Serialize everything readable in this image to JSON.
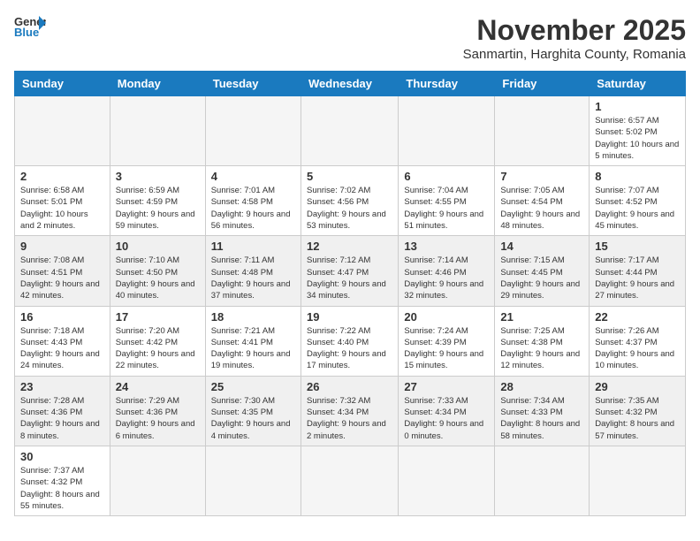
{
  "logo": {
    "text_general": "General",
    "text_blue": "Blue"
  },
  "title": "November 2025",
  "location": "Sanmartin, Harghita County, Romania",
  "days_of_week": [
    "Sunday",
    "Monday",
    "Tuesday",
    "Wednesday",
    "Thursday",
    "Friday",
    "Saturday"
  ],
  "weeks": [
    [
      {
        "day": "",
        "info": ""
      },
      {
        "day": "",
        "info": ""
      },
      {
        "day": "",
        "info": ""
      },
      {
        "day": "",
        "info": ""
      },
      {
        "day": "",
        "info": ""
      },
      {
        "day": "",
        "info": ""
      },
      {
        "day": "1",
        "info": "Sunrise: 6:57 AM\nSunset: 5:02 PM\nDaylight: 10 hours and 5 minutes."
      }
    ],
    [
      {
        "day": "2",
        "info": "Sunrise: 6:58 AM\nSunset: 5:01 PM\nDaylight: 10 hours and 2 minutes."
      },
      {
        "day": "3",
        "info": "Sunrise: 6:59 AM\nSunset: 4:59 PM\nDaylight: 9 hours and 59 minutes."
      },
      {
        "day": "4",
        "info": "Sunrise: 7:01 AM\nSunset: 4:58 PM\nDaylight: 9 hours and 56 minutes."
      },
      {
        "day": "5",
        "info": "Sunrise: 7:02 AM\nSunset: 4:56 PM\nDaylight: 9 hours and 53 minutes."
      },
      {
        "day": "6",
        "info": "Sunrise: 7:04 AM\nSunset: 4:55 PM\nDaylight: 9 hours and 51 minutes."
      },
      {
        "day": "7",
        "info": "Sunrise: 7:05 AM\nSunset: 4:54 PM\nDaylight: 9 hours and 48 minutes."
      },
      {
        "day": "8",
        "info": "Sunrise: 7:07 AM\nSunset: 4:52 PM\nDaylight: 9 hours and 45 minutes."
      }
    ],
    [
      {
        "day": "9",
        "info": "Sunrise: 7:08 AM\nSunset: 4:51 PM\nDaylight: 9 hours and 42 minutes."
      },
      {
        "day": "10",
        "info": "Sunrise: 7:10 AM\nSunset: 4:50 PM\nDaylight: 9 hours and 40 minutes."
      },
      {
        "day": "11",
        "info": "Sunrise: 7:11 AM\nSunset: 4:48 PM\nDaylight: 9 hours and 37 minutes."
      },
      {
        "day": "12",
        "info": "Sunrise: 7:12 AM\nSunset: 4:47 PM\nDaylight: 9 hours and 34 minutes."
      },
      {
        "day": "13",
        "info": "Sunrise: 7:14 AM\nSunset: 4:46 PM\nDaylight: 9 hours and 32 minutes."
      },
      {
        "day": "14",
        "info": "Sunrise: 7:15 AM\nSunset: 4:45 PM\nDaylight: 9 hours and 29 minutes."
      },
      {
        "day": "15",
        "info": "Sunrise: 7:17 AM\nSunset: 4:44 PM\nDaylight: 9 hours and 27 minutes."
      }
    ],
    [
      {
        "day": "16",
        "info": "Sunrise: 7:18 AM\nSunset: 4:43 PM\nDaylight: 9 hours and 24 minutes."
      },
      {
        "day": "17",
        "info": "Sunrise: 7:20 AM\nSunset: 4:42 PM\nDaylight: 9 hours and 22 minutes."
      },
      {
        "day": "18",
        "info": "Sunrise: 7:21 AM\nSunset: 4:41 PM\nDaylight: 9 hours and 19 minutes."
      },
      {
        "day": "19",
        "info": "Sunrise: 7:22 AM\nSunset: 4:40 PM\nDaylight: 9 hours and 17 minutes."
      },
      {
        "day": "20",
        "info": "Sunrise: 7:24 AM\nSunset: 4:39 PM\nDaylight: 9 hours and 15 minutes."
      },
      {
        "day": "21",
        "info": "Sunrise: 7:25 AM\nSunset: 4:38 PM\nDaylight: 9 hours and 12 minutes."
      },
      {
        "day": "22",
        "info": "Sunrise: 7:26 AM\nSunset: 4:37 PM\nDaylight: 9 hours and 10 minutes."
      }
    ],
    [
      {
        "day": "23",
        "info": "Sunrise: 7:28 AM\nSunset: 4:36 PM\nDaylight: 9 hours and 8 minutes."
      },
      {
        "day": "24",
        "info": "Sunrise: 7:29 AM\nSunset: 4:36 PM\nDaylight: 9 hours and 6 minutes."
      },
      {
        "day": "25",
        "info": "Sunrise: 7:30 AM\nSunset: 4:35 PM\nDaylight: 9 hours and 4 minutes."
      },
      {
        "day": "26",
        "info": "Sunrise: 7:32 AM\nSunset: 4:34 PM\nDaylight: 9 hours and 2 minutes."
      },
      {
        "day": "27",
        "info": "Sunrise: 7:33 AM\nSunset: 4:34 PM\nDaylight: 9 hours and 0 minutes."
      },
      {
        "day": "28",
        "info": "Sunrise: 7:34 AM\nSunset: 4:33 PM\nDaylight: 8 hours and 58 minutes."
      },
      {
        "day": "29",
        "info": "Sunrise: 7:35 AM\nSunset: 4:32 PM\nDaylight: 8 hours and 57 minutes."
      }
    ],
    [
      {
        "day": "30",
        "info": "Sunrise: 7:37 AM\nSunset: 4:32 PM\nDaylight: 8 hours and 55 minutes."
      },
      {
        "day": "",
        "info": ""
      },
      {
        "day": "",
        "info": ""
      },
      {
        "day": "",
        "info": ""
      },
      {
        "day": "",
        "info": ""
      },
      {
        "day": "",
        "info": ""
      },
      {
        "day": "",
        "info": ""
      }
    ]
  ]
}
